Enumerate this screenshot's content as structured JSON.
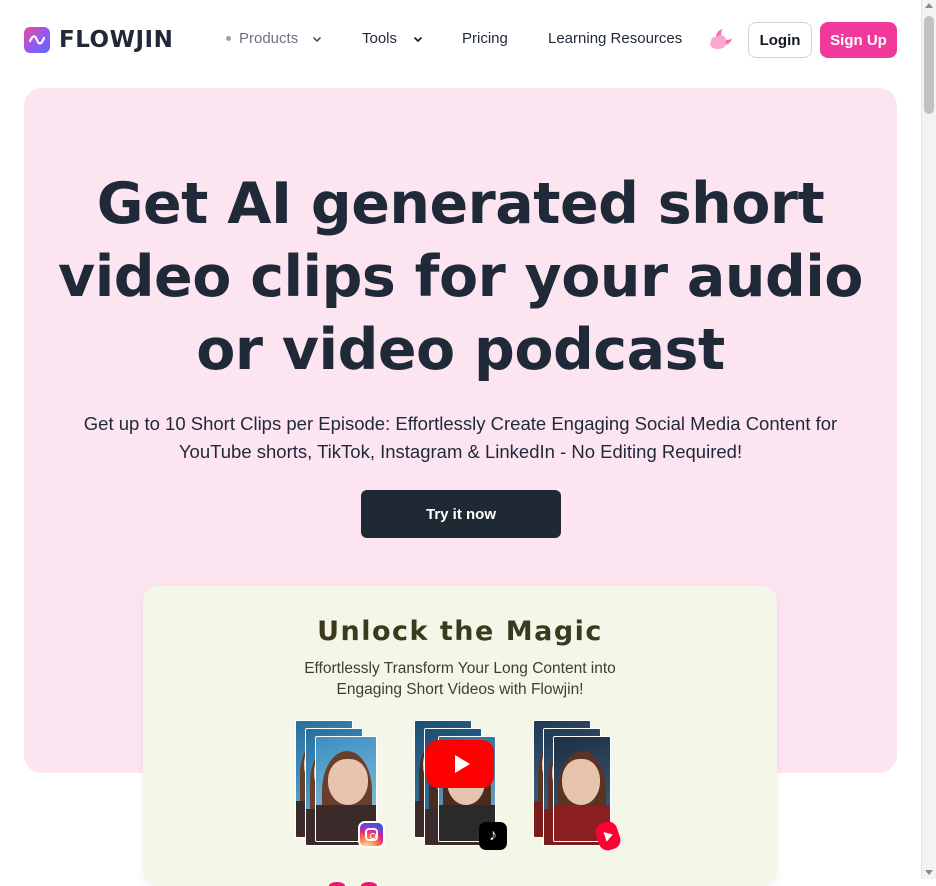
{
  "header": {
    "logo_text": "FLOWJIN",
    "nav": [
      {
        "label": "Products",
        "has_dropdown": true,
        "dimmed": true
      },
      {
        "label": "Tools",
        "has_dropdown": true,
        "dimmed": false
      },
      {
        "label": "Pricing",
        "has_dropdown": false,
        "dimmed": false
      },
      {
        "label": "Learning Resources",
        "has_dropdown": false,
        "dimmed": false
      }
    ],
    "theme_icon": "moon-cloud-icon",
    "login_label": "Login",
    "signup_label": "Sign Up"
  },
  "hero": {
    "title": "Get AI generated short video clips for your audio or video podcast",
    "subtitle": "Get up to 10 Short Clips per Episode: Effortlessly Create Engaging Social Media Content for YouTube shorts, TikTok, Instagram & LinkedIn - No Editing Required!",
    "cta_label": "Try it now"
  },
  "promo": {
    "title": "Unlock the Magic",
    "subtitle_line1": "Effortlessly Transform Your Long Content into",
    "subtitle_line2": "Engaging Short Videos with Flowjin!",
    "platform_icons": [
      "instagram-icon",
      "youtube-play-icon",
      "tiktok-icon",
      "youtube-shorts-icon"
    ]
  },
  "colors": {
    "brand_pink": "#f0399a",
    "hero_bg": "#fce4f1",
    "cta_dark": "#1f2933",
    "promo_bg": "#f4f6e8"
  }
}
